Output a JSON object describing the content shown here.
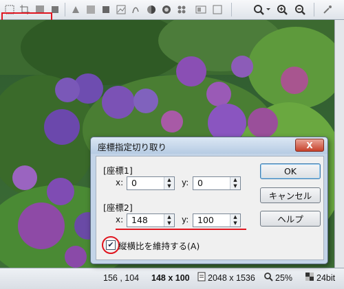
{
  "dialog": {
    "title": "座標指定切り取り",
    "close_label": "X",
    "section1": "[座標1]",
    "section2": "[座標2]",
    "coord1": {
      "x_label": "x:",
      "x_value": "0",
      "y_label": "y:",
      "y_value": "0"
    },
    "coord2": {
      "x_label": "x:",
      "x_value": "148",
      "y_label": "y:",
      "y_value": "100"
    },
    "ok_label": "OK",
    "cancel_label": "キャンセル",
    "help_label": "ヘルプ",
    "keep_aspect_label": "縦横比を維持する(A)",
    "keep_aspect_checked": true
  },
  "statusbar": {
    "cursor": "156 , 104",
    "selection": "148 x 100",
    "image_size": "2048 x 1536",
    "zoom": "25%",
    "bit_depth": "24bit"
  },
  "colors": {
    "highlight_red": "#e0141e",
    "title_bar": "#b6cbe3",
    "dialog_bg": "#c3d4e8"
  },
  "icons": [
    "select-icon",
    "crop-icon",
    "resize-icon",
    "rotate-icon",
    "flip-icon",
    "color-icon",
    "brightness-icon",
    "contrast-icon",
    "levels-icon",
    "grayscale-icon",
    "invert-icon",
    "effect-icon",
    "search-icon",
    "zoom-in-icon",
    "zoom-out-icon",
    "eyedropper-icon"
  ]
}
